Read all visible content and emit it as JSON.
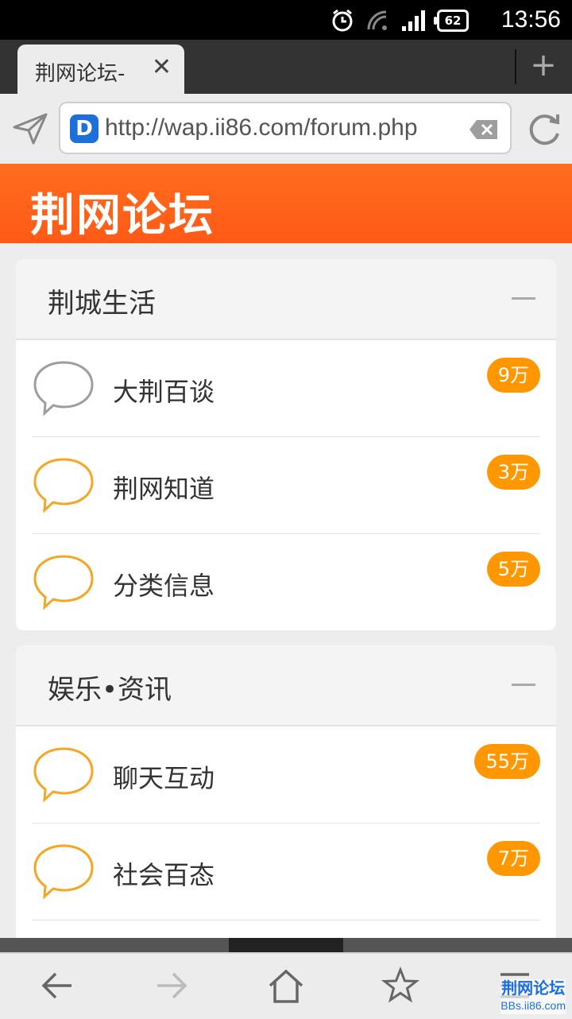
{
  "status_bar": {
    "time": "13:56",
    "battery": "62"
  },
  "browser": {
    "tab_title": "荆网论坛-",
    "url": "http://wap.ii86.com/forum.php",
    "new_tab_label": "+"
  },
  "banner": {
    "title": "荆网论坛"
  },
  "sections": [
    {
      "title": "荆城生活",
      "items": [
        {
          "label": "大荆百谈",
          "count": "9万"
        },
        {
          "label": "荆网知道",
          "count": "3万"
        },
        {
          "label": "分类信息",
          "count": "5万"
        }
      ]
    },
    {
      "title": "娱乐•资讯",
      "items": [
        {
          "label": "聊天互动",
          "count": "55万"
        },
        {
          "label": "社会百态",
          "count": "7万"
        }
      ]
    }
  ],
  "colors": {
    "accent": "#ff5a16",
    "badge": "#ff9800",
    "bubble_active": "#f5a623",
    "bubble_inactive": "#9e9e9e"
  },
  "watermark": {
    "line1": "荆网论坛",
    "line2": "BBs.ii86.com"
  }
}
